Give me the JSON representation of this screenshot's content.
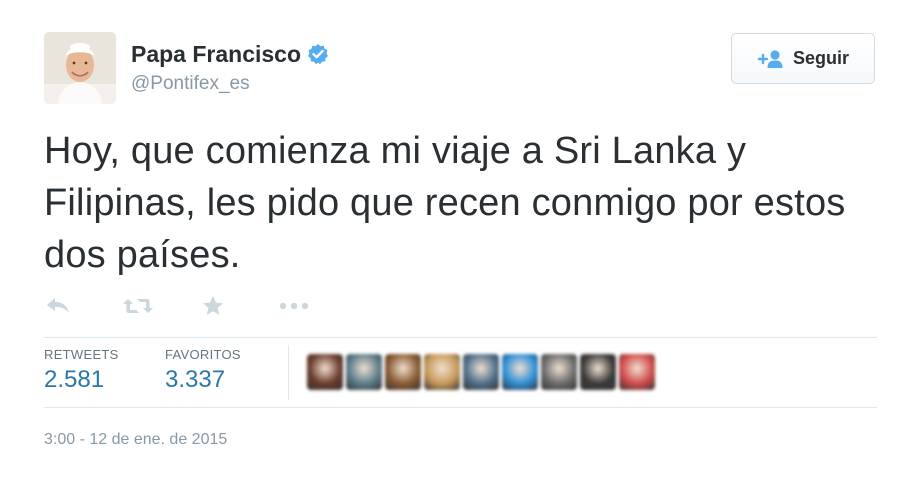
{
  "user": {
    "display_name": "Papa Francisco",
    "handle": "@Pontifex_es",
    "verified": true
  },
  "follow_button": {
    "label": "Seguir",
    "icon": "add-user-icon"
  },
  "tweet": {
    "text": "Hoy, que comienza mi viaje a Sri Lanka y Filipinas, les pido que recen conmigo por estos dos países."
  },
  "actions": [
    {
      "icon": "reply-icon"
    },
    {
      "icon": "retweet-icon"
    },
    {
      "icon": "favorite-star-icon"
    },
    {
      "icon": "more-dots-icon"
    }
  ],
  "stats": {
    "retweets_label": "RETWEETS",
    "retweets_value": "2.581",
    "favorites_label": "FAVORITOS",
    "favorites_value": "3.337"
  },
  "favoriters": [
    {
      "color": "#6b3b2c"
    },
    {
      "color": "#5b7c8a"
    },
    {
      "color": "#8a5a33"
    },
    {
      "color": "#c79a5a"
    },
    {
      "color": "#4f6f8a"
    },
    {
      "color": "#2f8fd8"
    },
    {
      "color": "#6b6b6b"
    },
    {
      "color": "#3a3a3a"
    },
    {
      "color": "#d24b4b"
    }
  ],
  "timestamp": "3:00 - 12 de ene. de 2015",
  "colors": {
    "link_blue": "#2a77a8",
    "verified_blue": "#55acee",
    "muted_gray": "#8899a6",
    "action_gray": "#ccd6dd"
  }
}
